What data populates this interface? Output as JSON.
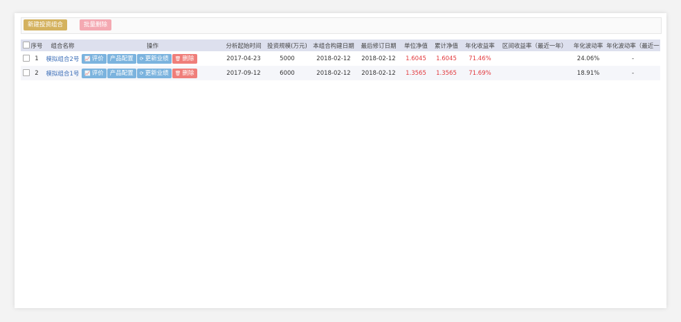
{
  "toolbar": {
    "new_label": "新建投资组合",
    "batch_delete_label": "批量删除"
  },
  "table": {
    "headers": {
      "seq": "序号",
      "name": "组合名称",
      "ops": "操作",
      "start_time": "分析起始时间",
      "scale": "投资规模(万元)",
      "build_date": "本组合构建日期",
      "modify_date": "最后修订日期",
      "unit_nav": "单位净值",
      "cum_nav": "累计净值",
      "ann_return": "年化收益率",
      "interval_return": "区间收益率（最近一年）",
      "ann_vol": "年化波动率",
      "ann_vol_recent": "年化波动率（最近一"
    },
    "ops_labels": {
      "evaluate": "评价",
      "config": "产品配置",
      "update": "更新业绩",
      "delete": "删除"
    },
    "rows": [
      {
        "seq": "1",
        "name": "模拟组合2号",
        "start_time": "2017-04-23",
        "scale": "5000",
        "build_date": "2018-02-12",
        "modify_date": "2018-02-12",
        "unit_nav": "1.6045",
        "cum_nav": "1.6045",
        "ann_return": "71.46%",
        "interval_return": "",
        "ann_vol": "24.06%",
        "ann_vol_recent": "-"
      },
      {
        "seq": "2",
        "name": "模拟组合1号",
        "start_time": "2017-09-12",
        "scale": "6000",
        "build_date": "2018-02-12",
        "modify_date": "2018-02-12",
        "unit_nav": "1.3565",
        "cum_nav": "1.3565",
        "ann_return": "71.69%",
        "interval_return": "",
        "ann_vol": "18.91%",
        "ann_vol_recent": "-"
      }
    ]
  },
  "icons": {
    "evaluate": "chart-icon",
    "update": "refresh-icon",
    "delete": "trash-icon"
  },
  "colors": {
    "accent_gold": "#d4b25f",
    "batch_pink": "#f4a9b2",
    "op_blue": "#7bb3de",
    "op_red": "#ef7e7a",
    "header_bg": "#dde0ee",
    "value_red": "#e2373b",
    "link_blue": "#3d6fb8"
  }
}
